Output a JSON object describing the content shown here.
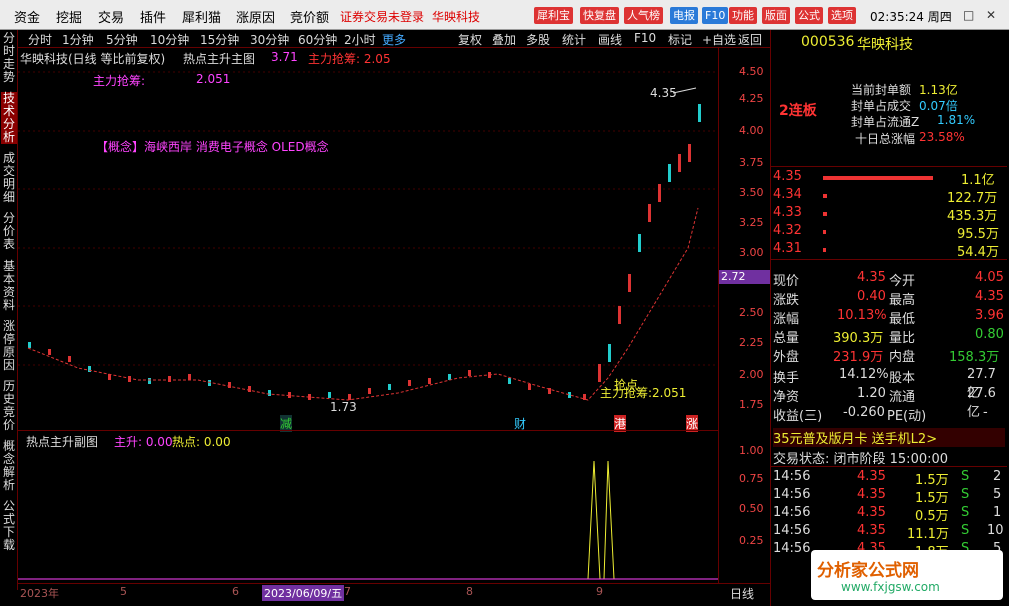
{
  "menubar": {
    "items": [
      "资金",
      "挖掘",
      "交易",
      "插件",
      "犀利猫",
      "涨原因",
      "竞价额"
    ],
    "status": "证券交易未登录",
    "stock": "华映科技",
    "pills": [
      "犀利宝",
      "快复盘",
      "人气榜",
      "电报",
      "F10",
      "功能",
      "版面",
      "公式",
      "选项"
    ],
    "clock": "02:35:24 周四"
  },
  "sidetabs": [
    "分时走势",
    "技术分析",
    "成交明细",
    "分价表",
    "基本资料",
    "涨停原因",
    "历史竞价",
    "概念解析",
    "公式下载"
  ],
  "period": {
    "items": [
      "分时",
      "1分钟",
      "5分钟",
      "10分钟",
      "15分钟",
      "30分钟",
      "60分钟",
      "2小时"
    ],
    "more": "更多",
    "tools": [
      "复权",
      "叠加",
      "多股",
      "统计",
      "画线",
      "F10",
      "标记",
      "+自选",
      "返回"
    ]
  },
  "chart": {
    "title": "华映科技(日线 等比前复权)",
    "indicator": "热点主升主图",
    "ind_val": "3.71",
    "zl_label": "主力抢筹: 2.05",
    "legend_label": "主力抢筹:",
    "legend_val": "2.051",
    "concept": "【概念】海峡西岸 消费电子概念 OLED概念",
    "peak_label": "4.35",
    "low_label": "1.73",
    "ann1": "抢点",
    "ann2": "主力抢筹:2.051",
    "marks": [
      "减",
      "财",
      "港",
      "涨"
    ],
    "cur_price_tag": "2.72",
    "yticks": [
      "4.50",
      "4.25",
      "4.00",
      "3.75",
      "3.50",
      "3.25",
      "3.00",
      "2.75",
      "2.50",
      "2.25",
      "2.00",
      "1.75"
    ]
  },
  "sub": {
    "title": "热点主升副图",
    "l1": "主升: 0.00",
    "l2": "热点: 0.00",
    "yticks": [
      "1.00",
      "0.75",
      "0.50",
      "0.25"
    ]
  },
  "datebar": {
    "dates": [
      "2023年",
      "5",
      "6",
      "2023/06/09/五",
      "7",
      "8",
      "9"
    ],
    "period": "日线"
  },
  "right": {
    "code": "000536",
    "name": "华映科技",
    "seal_amt_l": "当前封单额",
    "seal_amt": "1.13亿",
    "seal_vol_l": "封单占成交",
    "seal_vol": "0.07倍",
    "seal_float_l": "封单占流通Z",
    "seal_float": "1.81%",
    "ten_l": "十日总涨幅",
    "ten": "23.58%",
    "limit": "2连板",
    "bids": [
      {
        "p": "4.35",
        "v": "1.1亿"
      },
      {
        "p": "4.34",
        "v": "122.7万"
      },
      {
        "p": "4.33",
        "v": "435.3万"
      },
      {
        "p": "4.32",
        "v": "95.5万"
      },
      {
        "p": "4.31",
        "v": "54.4万"
      }
    ],
    "quote": [
      [
        "现价",
        "4.35",
        "今开",
        "4.05"
      ],
      [
        "涨跌",
        "0.40",
        "最高",
        "4.35"
      ],
      [
        "涨幅",
        "10.13%",
        "最低",
        "3.96"
      ],
      [
        "总量",
        "390.3万",
        "量比",
        "0.80"
      ],
      [
        "外盘",
        "231.9万",
        "内盘",
        "158.3万"
      ],
      [
        "换手",
        "14.12%",
        "股本",
        "27.7亿"
      ],
      [
        "净资",
        "1.20",
        "流通",
        "27.6亿"
      ],
      [
        "收益(三)",
        "-0.260",
        "PE(动)",
        "-"
      ]
    ],
    "promo": "35元普及版月卡 送手机L2>",
    "trade_state": "交易状态: 闭市阶段 15:00:00",
    "ticks": [
      [
        "14:56",
        "4.35",
        "1.5万",
        "S",
        "2"
      ],
      [
        "14:56",
        "4.35",
        "1.5万",
        "S",
        "5"
      ],
      [
        "14:56",
        "4.35",
        "0.5万",
        "S",
        "1"
      ],
      [
        "14:56",
        "4.35",
        "11.1万",
        "S",
        "10"
      ],
      [
        "14:56",
        "4.35",
        "1.8万",
        "S",
        "5"
      ]
    ],
    "logo": "分析家公式网",
    "logo_url": "www.fxjgsw.com"
  }
}
